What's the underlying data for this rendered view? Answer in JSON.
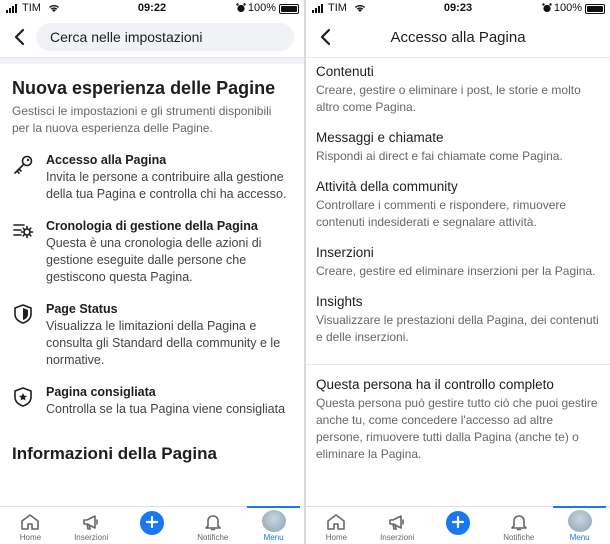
{
  "status_left": {
    "carrier": "TIM",
    "time": "09:22",
    "battery": "100%"
  },
  "status_right": {
    "carrier": "TIM",
    "time": "09:23",
    "battery": "100%"
  },
  "left_screen": {
    "search_placeholder": "Cerca nelle impostazioni",
    "section_title": "Nuova esperienza delle Pagine",
    "section_subtitle": "Gestisci le impostazioni e gli strumenti disponibili per la nuova esperienza delle Pagine.",
    "options": [
      {
        "title": "Accesso alla Pagina",
        "desc": "Invita le persone a contribuire alla gestione della tua Pagina e controlla chi ha accesso.",
        "icon": "key-icon"
      },
      {
        "title": "Cronologia di gestione della Pagina",
        "desc": "Questa è una cronologia delle azioni di gestione eseguite dalle persone che gestiscono questa Pagina.",
        "icon": "history-gear-icon"
      },
      {
        "title": "Page Status",
        "desc": "Visualizza le limitazioni della Pagina e consulta gli Standard della community e le normative.",
        "icon": "shield-icon"
      },
      {
        "title": "Pagina consigliata",
        "desc": "Controlla se la tua Pagina viene consigliata",
        "icon": "star-shield-icon"
      }
    ],
    "bottom_section": "Informazioni della Pagina"
  },
  "right_screen": {
    "title": "Accesso alla Pagina",
    "permissions": [
      {
        "title": "Contenuti",
        "desc": "Creare, gestire o eliminare i post, le storie e molto altro come Pagina."
      },
      {
        "title": "Messaggi e chiamate",
        "desc": "Rispondi ai direct e fai chiamate come Pagina."
      },
      {
        "title": "Attività della community",
        "desc": "Controllare i commenti e rispondere, rimuovere contenuti indesiderati e segnalare attività."
      },
      {
        "title": "Inserzioni",
        "desc": "Creare, gestire ed eliminare inserzioni per la Pagina."
      },
      {
        "title": "Insights",
        "desc": "Visualizzare le prestazioni della Pagina, dei contenuti e delle inserzioni."
      }
    ],
    "control": {
      "title": "Questa persona ha il controllo completo",
      "desc": "Questa persona può gestire tutto ciò che puoi gestire anche tu, come concedere l'accesso ad altre persone, rimuovere tutti dalla Pagina (anche te) o eliminare la Pagina."
    }
  },
  "tabs": [
    "Home",
    "Inserzioni",
    "",
    "Notifiche",
    "Menu"
  ],
  "colors": {
    "accent": "#1877f2",
    "secondary_text": "#65676b"
  }
}
